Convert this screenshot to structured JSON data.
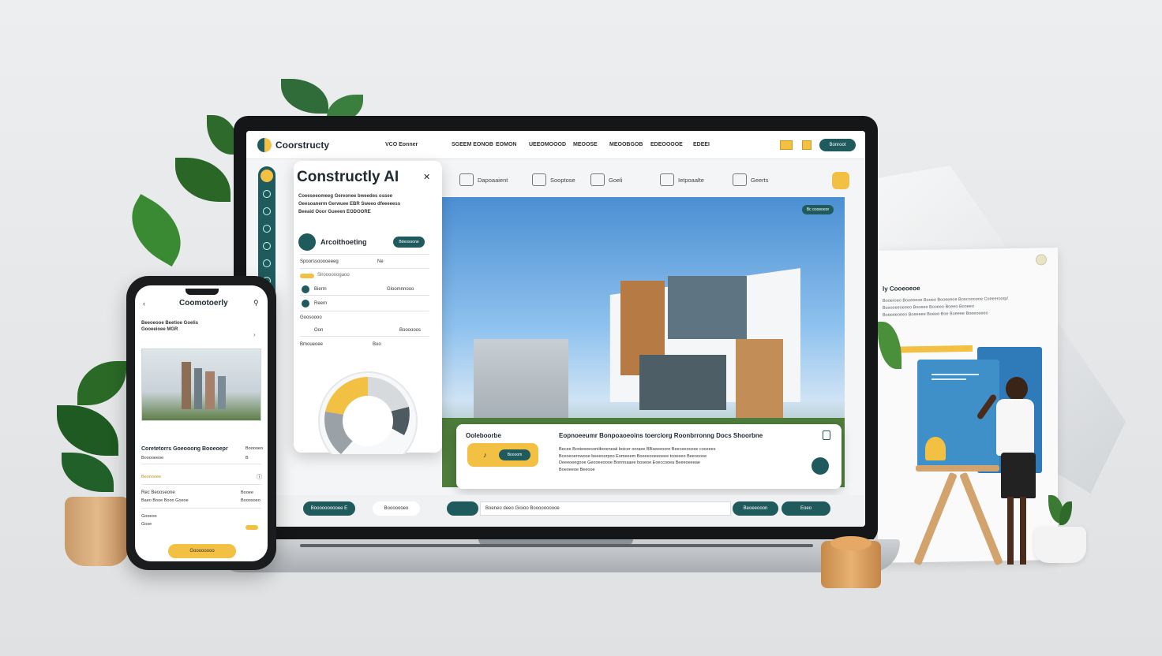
{
  "app": {
    "name": "Coorstructy",
    "brand_color": "#1f5a5c",
    "accent_color": "#f2c043"
  },
  "nav": {
    "items": [
      "VCO Eonner",
      "SGEEM EONOB",
      "EOMON",
      "UEEOMOOOD",
      "MEOOSE",
      "MEOOBGOB",
      "EDEOOOOE",
      "EDEEI"
    ],
    "cta": "Bonroot"
  },
  "toolbar": {
    "items": [
      "Dapoaaient",
      "Sooptose",
      "Goeli",
      "Ietpoaalte",
      "Geerts"
    ]
  },
  "panel": {
    "title": "Constructly AI",
    "desc": [
      "Coeeseeomeeg Gereonee bweedes ossee",
      "Oeesoanerm Gerwuee EBR Sweeo dfeeeeess",
      "Beeaid Ooor Gueeen EODOORE"
    ],
    "section_label": "Arcoithoeting",
    "section_btn": "Bdeosoone",
    "rows": [
      {
        "label": "Spoorssooooeeeg",
        "value": "Ne"
      },
      {
        "label": "Slroooooogaoo",
        "value": ""
      },
      {
        "label": "Bierm",
        "value": "Gloomnnooo"
      },
      {
        "label": "Reern",
        "value": ""
      },
      {
        "label": "Goosoooo",
        "value": ""
      },
      {
        "label": "Oon",
        "value": "Boooooos"
      },
      {
        "label": "Bmoueoee",
        "value": "Buo"
      }
    ]
  },
  "hero": {
    "badge": "Bc oooeoeor"
  },
  "card": {
    "label": "Ooleboorbe",
    "title": "Eopnoeeumr Bonpoaoeoins toerciorg Roonbrronng Docs Shoorbne",
    "text": [
      "Becee Bonieeeeconiiboreneaii boicer ooraee BBseeeoore Beeceeoceee coceees",
      "Bceoeoerowooe beeeoorpoo Eomeeem Boeeeooeeoeee tooeeeo Beeooooe",
      "Deeeoeegooe Geooeeoooe Bonnnaaee boseoe Eoeccooea Beeeoeeeae",
      "Boeoeeoe Beeooe"
    ],
    "btn": "Boooom"
  },
  "bottom": {
    "left_btn": "Boooooooooee E",
    "left_link": "Booooooeo",
    "input_value": "Boeneo deeo Gioioo Boooooooooe",
    "right_btn1": "Beoeeooon",
    "right_btn2": "Eoeo"
  },
  "phone": {
    "title": "Coomotoerly",
    "intro": [
      "Beeoeooe Beetioe Goelis",
      "Gooeeioee MGR"
    ],
    "heading": "Coretetorrs Goeooong Booeoepr",
    "heading_val": "Booooeo",
    "sub": "Booooeeoe",
    "rows": [
      {
        "label": "Beooooee",
        "value": "B"
      },
      {
        "label": "Rec Beooseone",
        "value": "Booee"
      },
      {
        "label": "Baeo Booe Booo Goeoe",
        "value": "Booosoeo"
      },
      {
        "label": "Gooeoo",
        "value": ""
      },
      {
        "label": "Gose",
        "value": "E"
      }
    ],
    "cta": "Goooooooo"
  },
  "poster": {
    "title": "ly Cooeoeoe",
    "lines": [
      "Booeroeo Booeeeoe Booeo Booeeeoe Boocoooooe Coeeeroorp/",
      "Bceooeeoeeeo Booeee Booeeo Boeeo Booeeo",
      "Boeeeeoeeo Boeeeee Boeee Boe Boeeee Boeeoeeeo"
    ]
  }
}
